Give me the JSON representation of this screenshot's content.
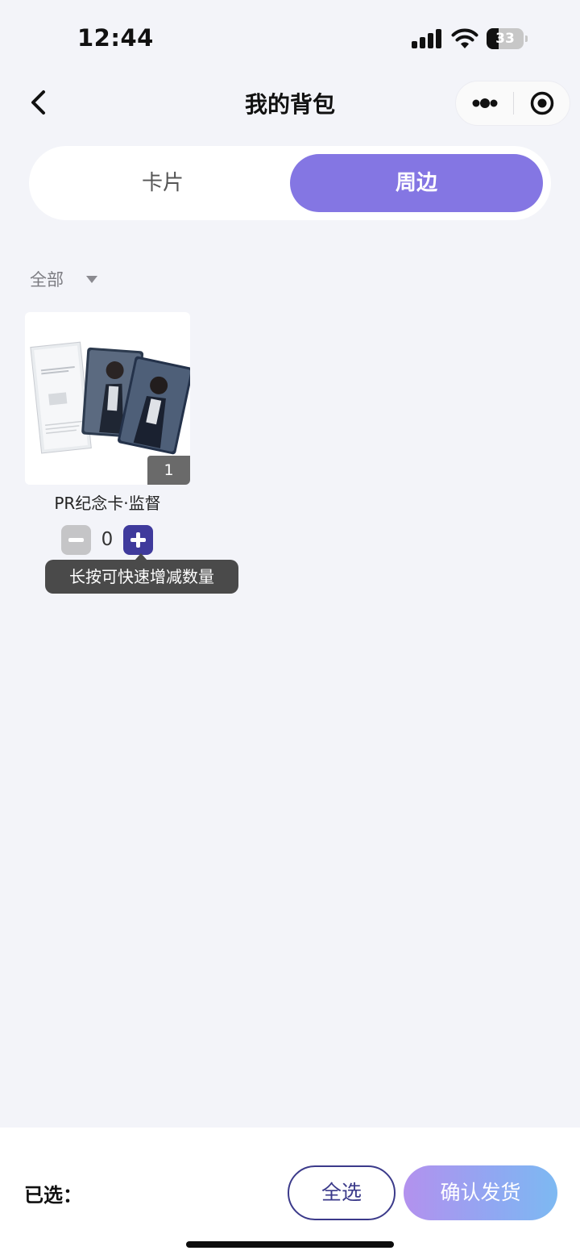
{
  "status_bar": {
    "time": "12:44",
    "battery": "33",
    "battery_level": 0.33,
    "icons": [
      "signal-icon",
      "wifi-icon",
      "battery-icon"
    ]
  },
  "nav": {
    "title": "我的背包",
    "back_icon": "chevron-left-icon",
    "more_icon": "more-dots-icon",
    "close_icon": "target-circle-icon"
  },
  "tabs": [
    {
      "label": "卡片",
      "active": false
    },
    {
      "label": "周边",
      "active": true
    }
  ],
  "filter": {
    "label": "全部",
    "icon": "caret-down-icon"
  },
  "items": [
    {
      "name": "PR纪念卡·监督",
      "owned_quantity": "1",
      "selected_count": "0",
      "tooltip": "长按可快速增减数量"
    }
  ],
  "bottom_bar": {
    "selected_label": "已选：",
    "select_all_label": "全选",
    "confirm_label": "确认发货"
  },
  "colors": {
    "accent": "#8476e3",
    "plus_button": "#3f3a9c",
    "minus_button": "#c5c5c7",
    "background": "#f3f4f9",
    "tooltip": "#4a4a4a"
  }
}
